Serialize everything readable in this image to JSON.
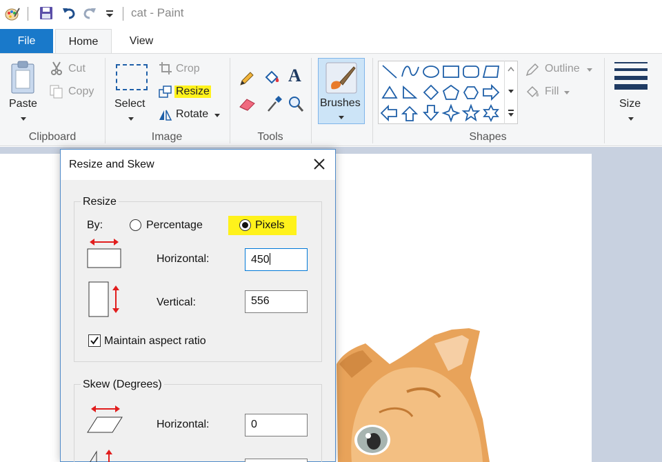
{
  "window": {
    "title": "cat - Paint"
  },
  "tabs": {
    "file": "File",
    "home": "Home",
    "view": "View"
  },
  "ribbon": {
    "clipboard": {
      "paste": "Paste",
      "cut": "Cut",
      "copy": "Copy",
      "label": "Clipboard"
    },
    "image": {
      "select": "Select",
      "crop": "Crop",
      "resize": "Resize",
      "rotate": "Rotate",
      "label": "Image"
    },
    "tools": {
      "label": "Tools"
    },
    "brushes": {
      "label": "Brushes"
    },
    "shapes": {
      "outline": "Outline",
      "fill": "Fill",
      "label": "Shapes"
    },
    "size": {
      "label": "Size"
    },
    "highlight_color": "#fff21b"
  },
  "dialog": {
    "title": "Resize and Skew",
    "resize": {
      "legend": "Resize",
      "by_label": "By:",
      "percentage": "Percentage",
      "pixels": "Pixels",
      "selected": "Pixels",
      "horizontal_label": "Horizontal:",
      "horizontal_value": "450",
      "vertical_label": "Vertical:",
      "vertical_value": "556",
      "maintain_label": "Maintain aspect ratio",
      "maintain_checked": true
    },
    "skew": {
      "legend": "Skew (Degrees)",
      "horizontal_label": "Horizontal:",
      "horizontal_value": "0"
    }
  },
  "colors": {
    "file_tab": "#1979ca",
    "ribbon_bg": "#f5f6f7",
    "workspace": "#c8d1e0",
    "accent_blue": "#1e5fa8",
    "red_arrow": "#e11d1d"
  }
}
